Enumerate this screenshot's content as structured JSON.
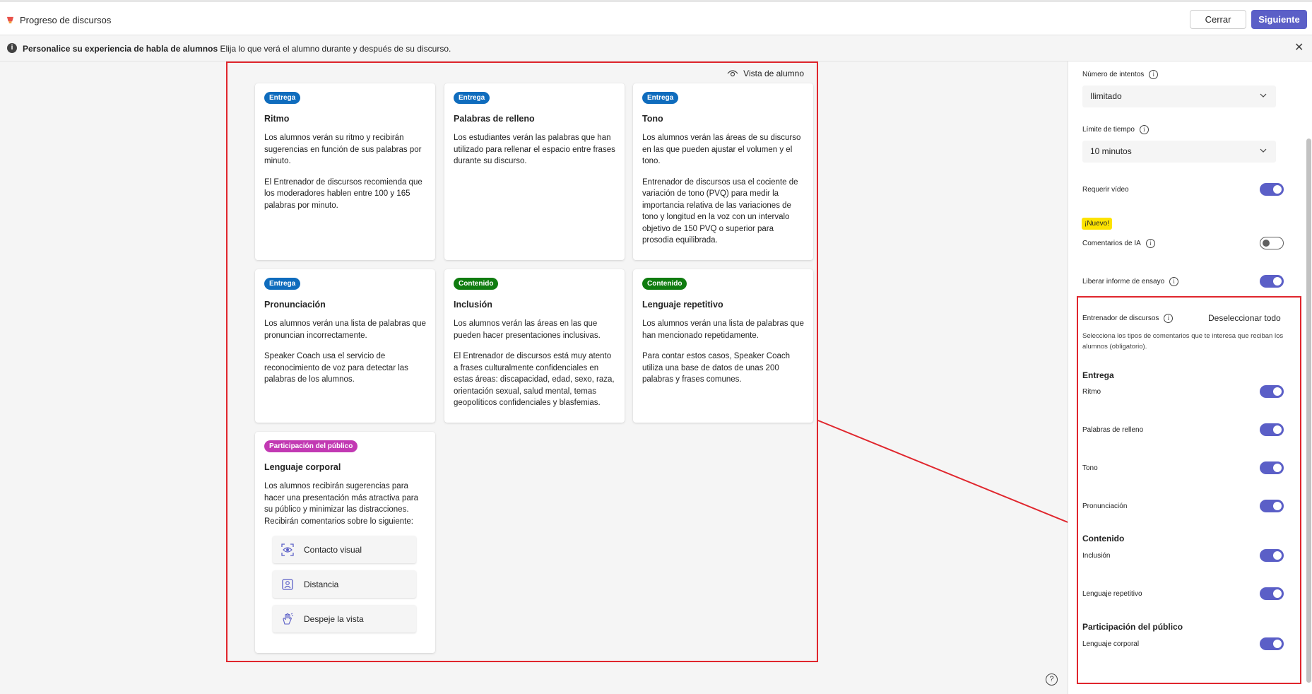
{
  "header": {
    "title": "Progreso de discursos",
    "close_label": "Cerrar",
    "next_label": "Siguiente"
  },
  "banner": {
    "title": "Personalice su experiencia de habla de alumnos",
    "text": "Elija lo que verá el alumno durante y después de su discurso."
  },
  "preview": {
    "student_view_label": "Vista de alumno"
  },
  "cards": [
    {
      "badge": "Entrega",
      "title": "Ritmo",
      "paragraphs": [
        "Los alumnos verán su ritmo y recibirán sugerencias en función de sus palabras por minuto.",
        "El Entrenador de discursos recomienda que los moderadores hablen entre 100 y 165 palabras por minuto."
      ]
    },
    {
      "badge": "Entrega",
      "title": "Palabras de relleno",
      "paragraphs": [
        "Los estudiantes verán las palabras que han utilizado para rellenar el espacio entre frases durante su discurso."
      ]
    },
    {
      "badge": "Entrega",
      "title": "Tono",
      "paragraphs": [
        "Los alumnos verán las áreas de su discurso en las que pueden ajustar el volumen y el tono.",
        "Entrenador de discursos usa el cociente de variación de tono (PVQ) para medir la importancia relativa de las variaciones de tono y longitud en la voz con un intervalo objetivo de 150 PVQ o superior para prosodia equilibrada."
      ]
    },
    {
      "badge": "Entrega",
      "title": "Pronunciación",
      "paragraphs": [
        "Los alumnos verán una lista de palabras que pronuncian incorrectamente.",
        "Speaker Coach usa el servicio de reconocimiento de voz para detectar las palabras de los alumnos."
      ]
    },
    {
      "badge": "Contenido",
      "title": "Inclusión",
      "paragraphs": [
        "Los alumnos verán las áreas en las que pueden hacer presentaciones inclusivas.",
        "El Entrenador de discursos está muy atento a frases culturalmente confidenciales en estas áreas: discapacidad, edad, sexo, raza, orientación sexual, salud mental, temas geopolíticos confidenciales y blasfemias."
      ]
    },
    {
      "badge": "Contenido",
      "title": "Lenguaje repetitivo",
      "paragraphs": [
        "Los alumnos verán una lista de palabras que han mencionado repetidamente.",
        "Para contar estos casos, Speaker Coach utiliza una base de datos de unas 200 palabras y frases comunes."
      ]
    },
    {
      "badge": "Participación del público",
      "title": "Lenguaje corporal",
      "paragraphs": [
        "Los alumnos recibirán sugerencias para hacer una presentación más atractiva para su público y minimizar las distracciones. Recibirán comentarios sobre lo siguiente:"
      ],
      "chips": [
        "Contacto visual",
        "Distancia",
        "Despeje la vista"
      ]
    }
  ],
  "settings": {
    "attempts_label": "Número de intentos",
    "attempts_value": "Ilimitado",
    "time_label": "Límite de tiempo",
    "time_value": "10 minutos",
    "require_video_label": "Requerir vídeo",
    "new_badge": "¡Nuevo!",
    "ai_feedback_label": "Comentarios de IA",
    "release_report_label": "Liberar informe de ensayo",
    "coach_label": "Entrenador de discursos",
    "deselect_all": "Deseleccionar todo",
    "coach_description": "Selecciona los tipos de comentarios que te interesa que reciban los alumnos (obligatorio).",
    "sections": [
      {
        "heading": "Entrega",
        "items": [
          "Ritmo",
          "Palabras de relleno",
          "Tono",
          "Pronunciación"
        ]
      },
      {
        "heading": "Contenido",
        "items": [
          "Inclusión",
          "Lenguaje repetitivo"
        ]
      },
      {
        "heading": "Participación del público",
        "items": [
          "Lenguaje corporal"
        ]
      }
    ]
  },
  "colors": {
    "accent": "#5b5fc7",
    "highlight_frame": "#e0262d",
    "entrega": "#0f6cbd",
    "contenido": "#107c10",
    "publico": "#c239b3"
  }
}
